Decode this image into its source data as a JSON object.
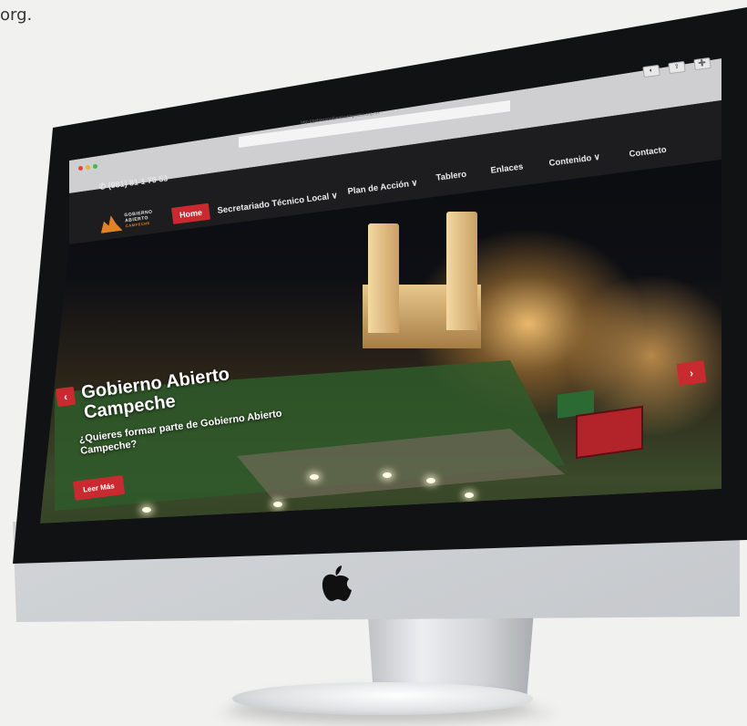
{
  "caption": "org.",
  "browser": {
    "url": "http://gobiernoabiertocampeche.org.mx",
    "buttons": [
      "◐",
      "⇧",
      "➕"
    ]
  },
  "site": {
    "phone": "(981) 81 1 79 53",
    "logo": {
      "line1": "GOBIERNO",
      "line2": "ABIERTO",
      "line3": "CAMPECHE"
    },
    "nav": {
      "home": "Home",
      "secretariado": "Secretariado Técnico Local ∨",
      "plan": "Plan de Acción ∨",
      "tablero": "Tablero",
      "enlaces": "Enlaces",
      "contenido": "Contenido ∨",
      "contacto": "Contacto"
    },
    "hero": {
      "title_line1": "Gobierno Abierto",
      "title_line2": "Campeche",
      "subtitle_line1": "¿Quieres formar parte de Gobierno Abierto",
      "subtitle_line2": "Campeche?",
      "cta": "Leer Más",
      "prev": "‹",
      "next": "›"
    }
  },
  "colors": {
    "accent": "#c92a2f",
    "navbar": "#1d1d1f",
    "logo": "#e0822a"
  }
}
